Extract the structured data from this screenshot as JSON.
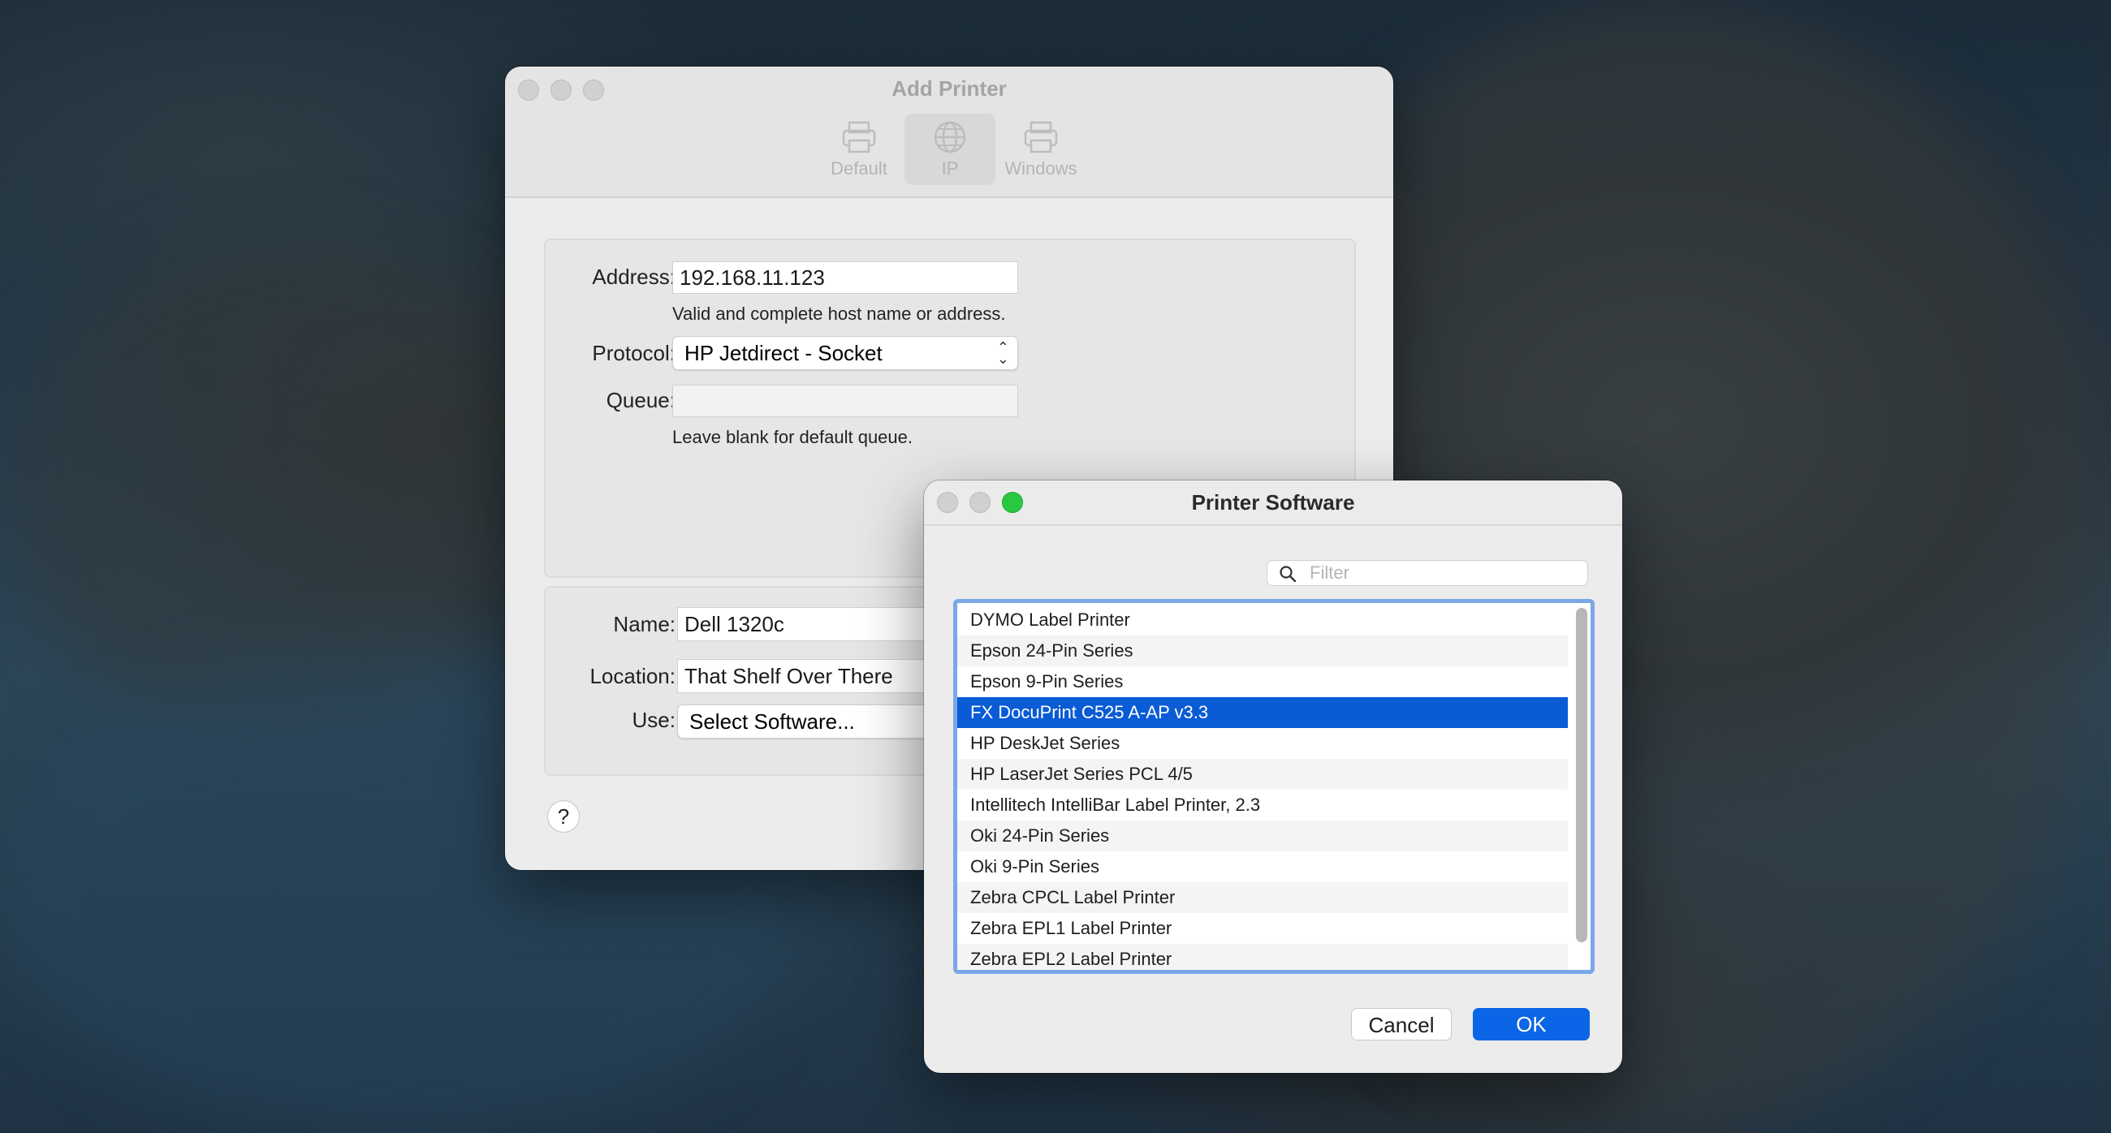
{
  "add_printer": {
    "title": "Add Printer",
    "tabs": [
      {
        "label": "Default",
        "icon": "printer-icon"
      },
      {
        "label": "IP",
        "icon": "globe-icon"
      },
      {
        "label": "Windows",
        "icon": "printer-icon"
      }
    ],
    "address_label": "Address:",
    "address_value": "192.168.11.123",
    "address_hint": "Valid and complete host name or address.",
    "protocol_label": "Protocol:",
    "protocol_value": "HP Jetdirect - Socket",
    "queue_label": "Queue:",
    "queue_value": "",
    "queue_hint": "Leave blank for default queue.",
    "name_label": "Name:",
    "name_value": "Dell 1320c",
    "location_label": "Location:",
    "location_value": "That Shelf Over There",
    "use_label": "Use:",
    "use_value": "Select Software...",
    "help_label": "?"
  },
  "printer_software": {
    "title": "Printer Software",
    "filter_placeholder": "Filter",
    "items": [
      "DYMO Label Printer",
      "Epson 24-Pin Series",
      "Epson 9-Pin Series",
      "FX DocuPrint C525 A-AP v3.3",
      "HP DeskJet Series",
      "HP LaserJet Series PCL 4/5",
      "Intellitech IntelliBar Label Printer, 2.3",
      "Oki 24-Pin Series",
      "Oki 9-Pin Series",
      "Zebra CPCL Label Printer",
      "Zebra EPL1 Label Printer",
      "Zebra EPL2 Label Printer"
    ],
    "selected_item": "FX DocuPrint C525 A-AP v3.3",
    "cancel_label": "Cancel",
    "ok_label": "OK"
  },
  "colors": {
    "selection": "#0a5bd6",
    "ok_button": "#0a66e6",
    "focus_ring": "#7aa7e8",
    "zoom_green": "#2ac840"
  }
}
